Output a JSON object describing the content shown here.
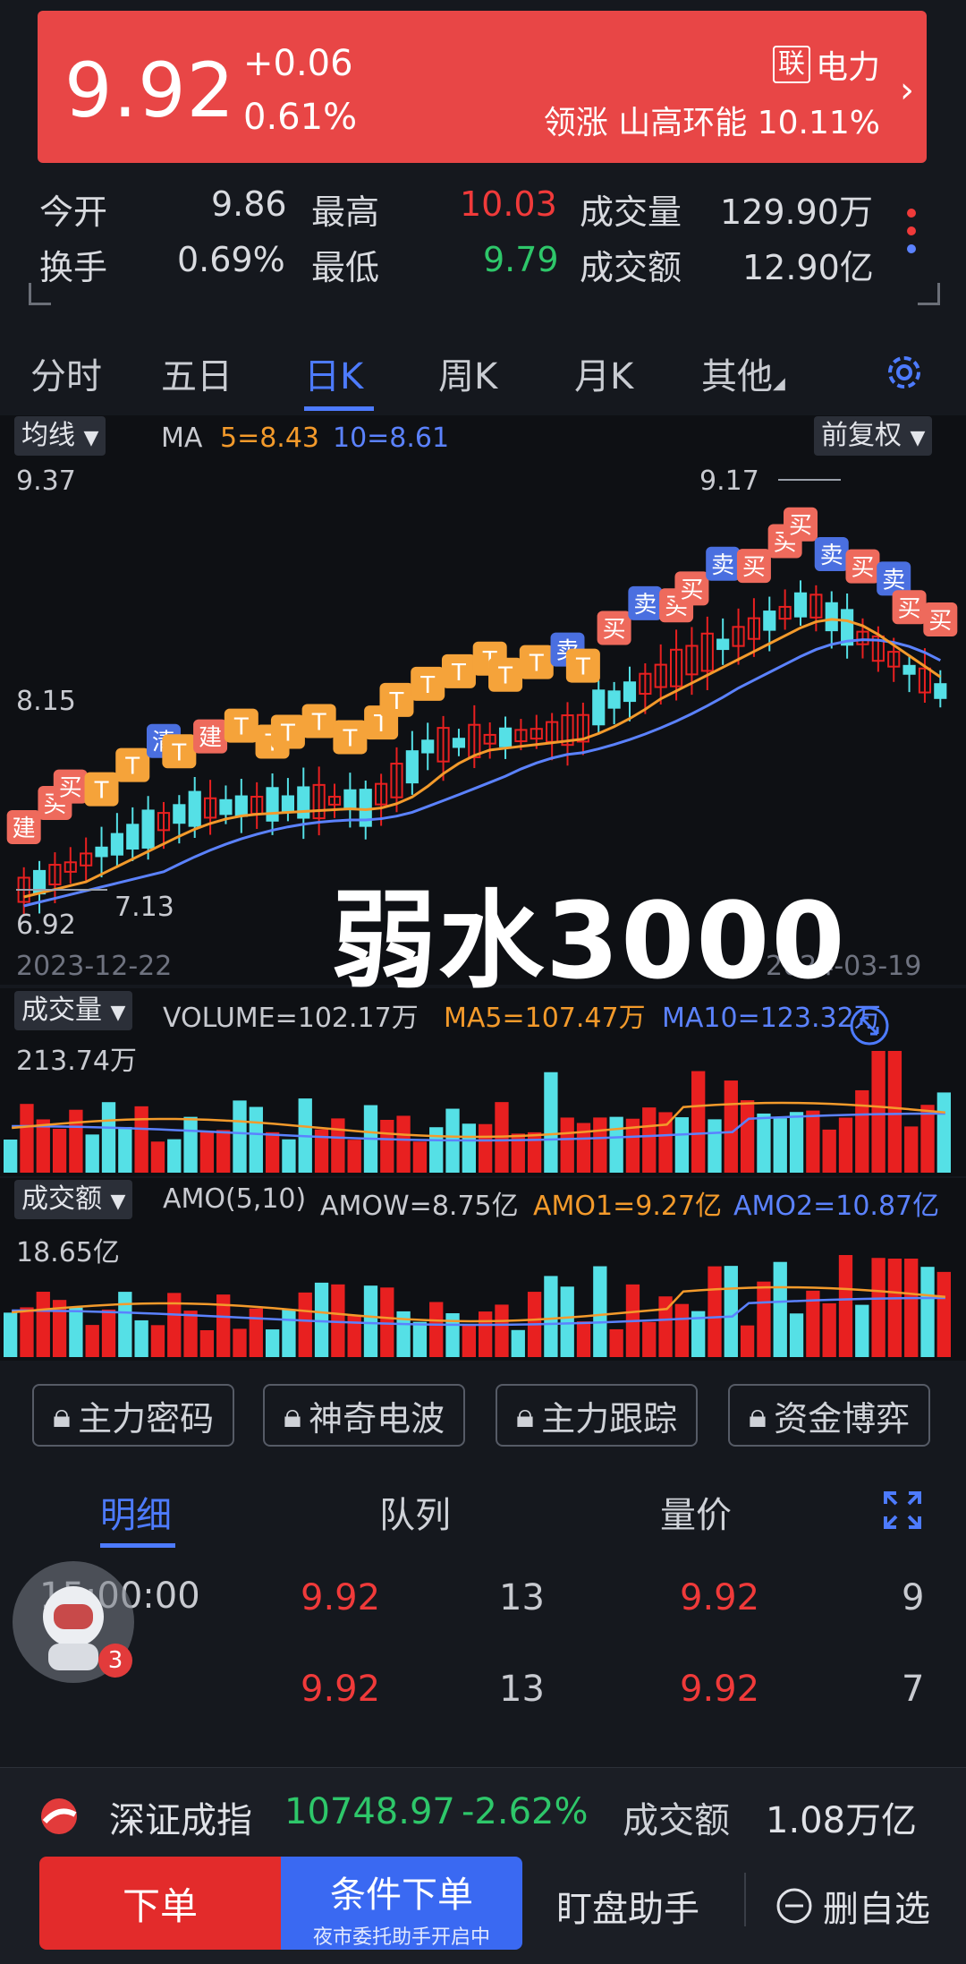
{
  "quote": {
    "price": "9.92",
    "change": "+0.06",
    "change_pct": "0.61%",
    "sector_badge": "联",
    "sector_name": "电力",
    "leader_label": "领涨",
    "leader_name": "山高环能",
    "leader_pct": "10.11%"
  },
  "stats": {
    "open_label": "今开",
    "open": "9.86",
    "high_label": "最高",
    "high": "10.03",
    "volume_label": "成交量",
    "volume": "129.90万",
    "turnover_label": "换手",
    "turnover": "0.69%",
    "low_label": "最低",
    "low": "9.79",
    "amount_label": "成交额",
    "amount": "12.90亿"
  },
  "tabs": [
    "分时",
    "五日",
    "日K",
    "周K",
    "月K",
    "其他"
  ],
  "active_tab": "日K",
  "kline": {
    "ma_dropdown": "均线",
    "ma_label": "MA",
    "ma5": "5=8.43",
    "ma10": "10=8.61",
    "adjust_dropdown": "前复权",
    "y_top": "9.37",
    "y_mid": "8.15",
    "y_bottom": "6.92",
    "high_mark": "9.17",
    "low_mark": "7.13",
    "date_start": "2023-12-22",
    "date_end": "2024-03-19",
    "watermark": "弱水3000",
    "signals": [
      "建",
      "买",
      "买",
      "T",
      "T",
      "清",
      "T",
      "建",
      "T",
      "T",
      "T",
      "T",
      "T",
      "T",
      "T",
      "T",
      "T",
      "T",
      "T",
      "T",
      "卖",
      "T",
      "买",
      "卖",
      "买",
      "买",
      "卖",
      "买",
      "买",
      "买",
      "卖",
      "买",
      "卖",
      "买",
      "买"
    ]
  },
  "volume": {
    "dropdown": "成交量",
    "label": "VOLUME=102.17万",
    "ma5": "MA5=107.47万",
    "ma10": "MA10=123.32万",
    "max": "213.74万"
  },
  "amount_panel": {
    "dropdown": "成交额",
    "label": "AMO(5,10)",
    "amow": "AMOW=8.75亿",
    "amo1": "AMO1=9.27亿",
    "amo2": "AMO2=10.87亿",
    "max": "18.65亿"
  },
  "features": [
    "主力密码",
    "神奇电波",
    "主力跟踪",
    "资金博弈"
  ],
  "detail_tabs": [
    "明细",
    "队列",
    "量价"
  ],
  "trades": [
    {
      "time": "15:00:00",
      "price": "9.92",
      "vol": "13",
      "price2": "9.92",
      "vol2": "9"
    },
    {
      "time": "",
      "price": "9.92",
      "vol": "13",
      "price2": "9.92",
      "vol2": "7"
    }
  ],
  "avatar_badge": "3",
  "index_bar": {
    "name": "深证成指",
    "value": "10748.97",
    "pct": "-2.62%",
    "amount_label": "成交额",
    "amount": "1.08万亿"
  },
  "actions": {
    "order": "下单",
    "condition": "条件下单",
    "condition_sub": "夜市委托助手开启中",
    "assistant": "盯盘助手",
    "remove": "删自选"
  },
  "colors": {
    "up": "#f03a3a",
    "down": "#2ec76a",
    "ma5": "#f39a2b",
    "ma10": "#5b82ff",
    "bear_bar": "#55e0e6",
    "bull_bar": "#e82020",
    "accent": "#4d7bff"
  }
}
